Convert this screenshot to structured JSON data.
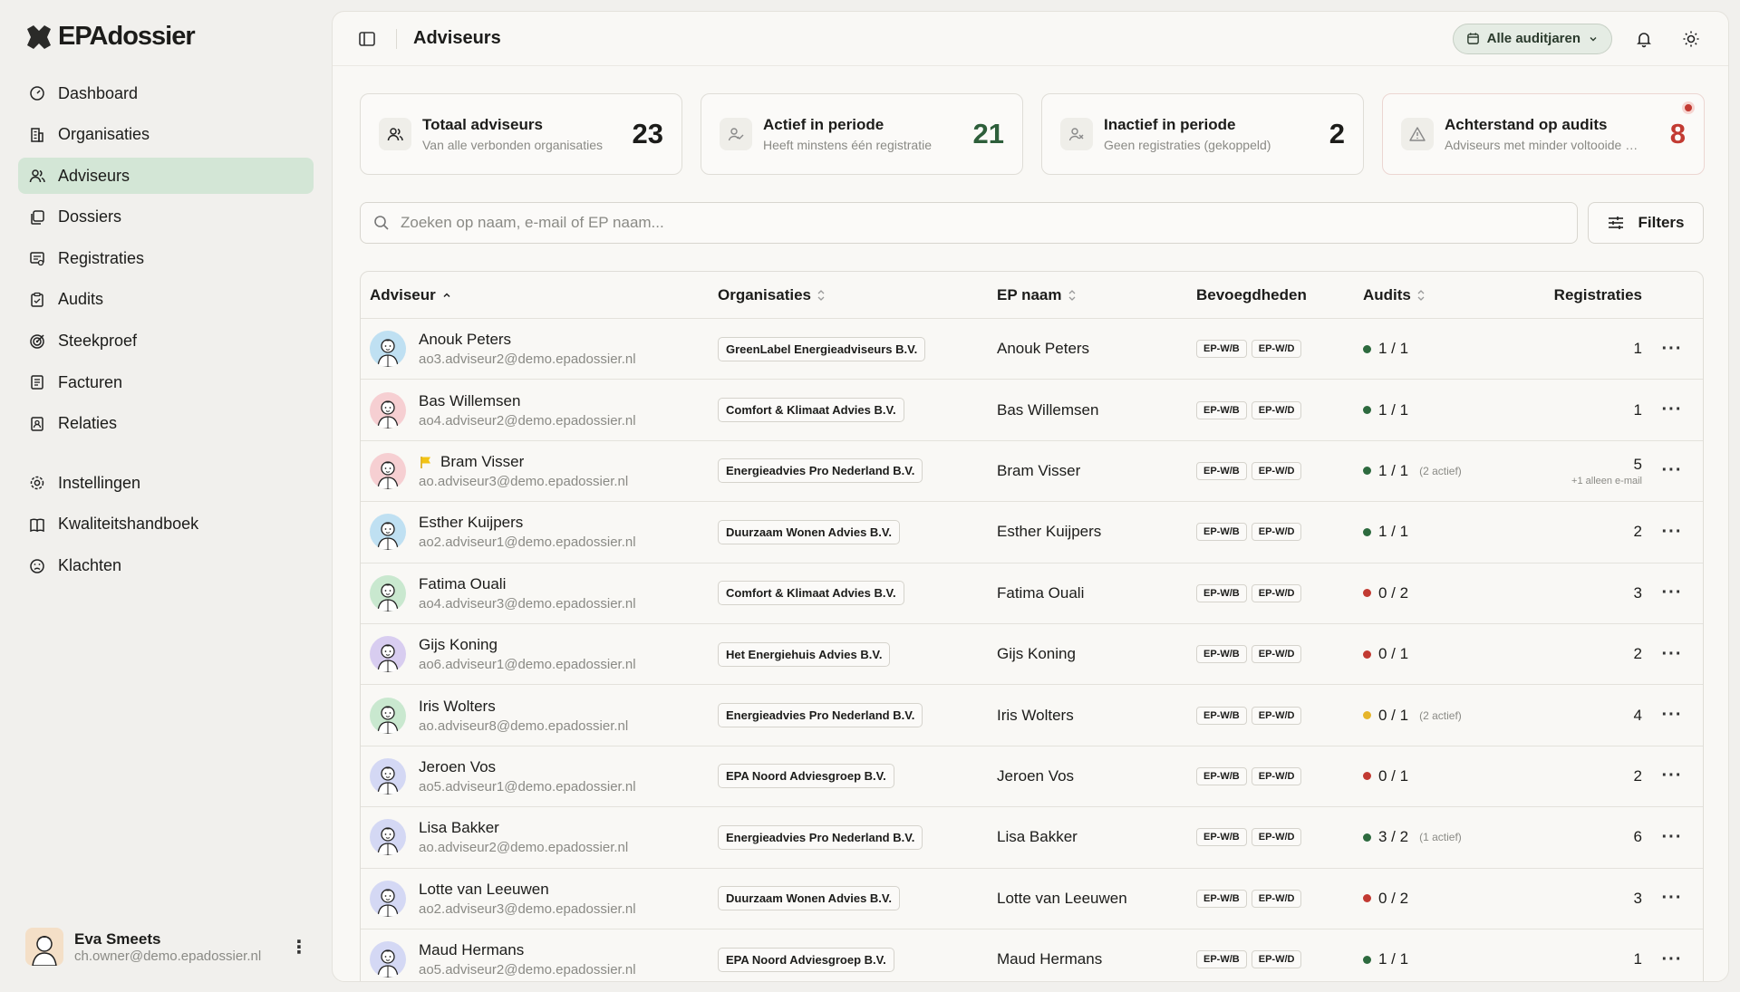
{
  "brand": {
    "name": "EPAdossier"
  },
  "nav": [
    {
      "label": "Dashboard",
      "icon": "dashboard-icon"
    },
    {
      "label": "Organisaties",
      "icon": "building-icon"
    },
    {
      "label": "Adviseurs",
      "icon": "users-icon",
      "active": true
    },
    {
      "label": "Dossiers",
      "icon": "folders-icon"
    },
    {
      "label": "Registraties",
      "icon": "registrations-icon"
    },
    {
      "label": "Audits",
      "icon": "clipboard-icon"
    },
    {
      "label": "Steekproef",
      "icon": "target-icon"
    },
    {
      "label": "Facturen",
      "icon": "invoice-icon"
    },
    {
      "label": "Relaties",
      "icon": "contacts-icon"
    }
  ],
  "nav_secondary": [
    {
      "label": "Instellingen",
      "icon": "gear-icon"
    },
    {
      "label": "Kwaliteitshandboek",
      "icon": "book-icon"
    },
    {
      "label": "Klachten",
      "icon": "frown-icon"
    }
  ],
  "user": {
    "name": "Eva Smeets",
    "email": "ch.owner@demo.epadossier.nl"
  },
  "topbar": {
    "title": "Adviseurs",
    "year_filter": "Alle auditjaren"
  },
  "stats": [
    {
      "title": "Totaal adviseurs",
      "sub": "Van alle verbonden organisaties",
      "value": "23",
      "color": "#1c1c1a",
      "icon": "users-icon"
    },
    {
      "title": "Actief in periode",
      "sub": "Heeft minstens één registratie",
      "value": "21",
      "color": "#2d5e3a",
      "icon": "user-check-icon"
    },
    {
      "title": "Inactief in periode",
      "sub": "Geen registraties (gekoppeld)",
      "value": "2",
      "color": "#1c1c1a",
      "icon": "user-x-icon"
    },
    {
      "title": "Achterstand op audits",
      "sub": "Adviseurs met minder voltooide audits",
      "value": "8",
      "color": "#c23a32",
      "icon": "warning-icon"
    }
  ],
  "search": {
    "placeholder": "Zoeken op naam, e-mail of EP naam..."
  },
  "filters_label": "Filters",
  "table": {
    "headers": {
      "adviseur": "Adviseur",
      "organisaties": "Organisaties",
      "ep_naam": "EP naam",
      "bevoegdheden": "Bevoegdheden",
      "audits": "Audits",
      "registraties": "Registraties"
    },
    "rows": [
      {
        "name": "Anouk Peters",
        "email": "ao3.adviseur2@demo.epadossier.nl",
        "org": "GreenLabel Energieadviseurs B.V.",
        "ep": "Anouk Peters",
        "bev": [
          "EP-W/B",
          "EP-W/D"
        ],
        "audit_status": "green",
        "audits": "1 / 1",
        "audit_note": "",
        "reg": "1",
        "reg_note": "",
        "avatar_bg": "#bfe0f2",
        "flag": false
      },
      {
        "name": "Bas Willemsen",
        "email": "ao4.adviseur2@demo.epadossier.nl",
        "org": "Comfort & Klimaat Advies B.V.",
        "ep": "Bas Willemsen",
        "bev": [
          "EP-W/B",
          "EP-W/D"
        ],
        "audit_status": "green",
        "audits": "1 / 1",
        "audit_note": "",
        "reg": "1",
        "reg_note": "",
        "avatar_bg": "#f6cfd2",
        "flag": false
      },
      {
        "name": "Bram Visser",
        "email": "ao.adviseur3@demo.epadossier.nl",
        "org": "Energieadvies Pro Nederland B.V.",
        "ep": "Bram Visser",
        "bev": [
          "EP-W/B",
          "EP-W/D"
        ],
        "audit_status": "green",
        "audits": "1 / 1",
        "audit_note": "(2 actief)",
        "reg": "5",
        "reg_note": "+1 alleen e-mail",
        "avatar_bg": "#f6cfd2",
        "flag": true
      },
      {
        "name": "Esther Kuijpers",
        "email": "ao2.adviseur1@demo.epadossier.nl",
        "org": "Duurzaam Wonen Advies B.V.",
        "ep": "Esther Kuijpers",
        "bev": [
          "EP-W/B",
          "EP-W/D"
        ],
        "audit_status": "green",
        "audits": "1 / 1",
        "audit_note": "",
        "reg": "2",
        "reg_note": "",
        "avatar_bg": "#bfe0f2",
        "flag": false
      },
      {
        "name": "Fatima Ouali",
        "email": "ao4.adviseur3@demo.epadossier.nl",
        "org": "Comfort & Klimaat Advies B.V.",
        "ep": "Fatima Ouali",
        "bev": [
          "EP-W/B",
          "EP-W/D"
        ],
        "audit_status": "red",
        "audits": "0 / 2",
        "audit_note": "",
        "reg": "3",
        "reg_note": "",
        "avatar_bg": "#c9e8cf",
        "flag": false
      },
      {
        "name": "Gijs Koning",
        "email": "ao6.adviseur1@demo.epadossier.nl",
        "org": "Het Energiehuis Advies B.V.",
        "ep": "Gijs Koning",
        "bev": [
          "EP-W/B",
          "EP-W/D"
        ],
        "audit_status": "red",
        "audits": "0 / 1",
        "audit_note": "",
        "reg": "2",
        "reg_note": "",
        "avatar_bg": "#d8cdf0",
        "flag": false
      },
      {
        "name": "Iris Wolters",
        "email": "ao.adviseur8@demo.epadossier.nl",
        "org": "Energieadvies Pro Nederland B.V.",
        "ep": "Iris Wolters",
        "bev": [
          "EP-W/B",
          "EP-W/D"
        ],
        "audit_status": "yellow",
        "audits": "0 / 1",
        "audit_note": "(2 actief)",
        "reg": "4",
        "reg_note": "",
        "avatar_bg": "#c9e8cf",
        "flag": false
      },
      {
        "name": "Jeroen Vos",
        "email": "ao5.adviseur1@demo.epadossier.nl",
        "org": "EPA Noord Adviesgroep B.V.",
        "ep": "Jeroen Vos",
        "bev": [
          "EP-W/B",
          "EP-W/D"
        ],
        "audit_status": "red",
        "audits": "0 / 1",
        "audit_note": "",
        "reg": "2",
        "reg_note": "",
        "avatar_bg": "#d4d8f4",
        "flag": false
      },
      {
        "name": "Lisa Bakker",
        "email": "ao.adviseur2@demo.epadossier.nl",
        "org": "Energieadvies Pro Nederland B.V.",
        "ep": "Lisa Bakker",
        "bev": [
          "EP-W/B",
          "EP-W/D"
        ],
        "audit_status": "green",
        "audits": "3 / 2",
        "audit_note": "(1 actief)",
        "reg": "6",
        "reg_note": "",
        "avatar_bg": "#d4d8f4",
        "flag": false
      },
      {
        "name": "Lotte van Leeuwen",
        "email": "ao2.adviseur3@demo.epadossier.nl",
        "org": "Duurzaam Wonen Advies B.V.",
        "ep": "Lotte van Leeuwen",
        "bev": [
          "EP-W/B",
          "EP-W/D"
        ],
        "audit_status": "red",
        "audits": "0 / 2",
        "audit_note": "",
        "reg": "3",
        "reg_note": "",
        "avatar_bg": "#d4d8f4",
        "flag": false
      },
      {
        "name": "Maud Hermans",
        "email": "ao5.adviseur2@demo.epadossier.nl",
        "org": "EPA Noord Adviesgroep B.V.",
        "ep": "Maud Hermans",
        "bev": [
          "EP-W/B",
          "EP-W/D"
        ],
        "audit_status": "green",
        "audits": "1 / 1",
        "audit_note": "",
        "reg": "1",
        "reg_note": "",
        "avatar_bg": "#d4d8f4",
        "flag": false
      }
    ]
  },
  "status_colors": {
    "green": "#2d6a3e",
    "red": "#c23a32",
    "yellow": "#e6b52a"
  }
}
